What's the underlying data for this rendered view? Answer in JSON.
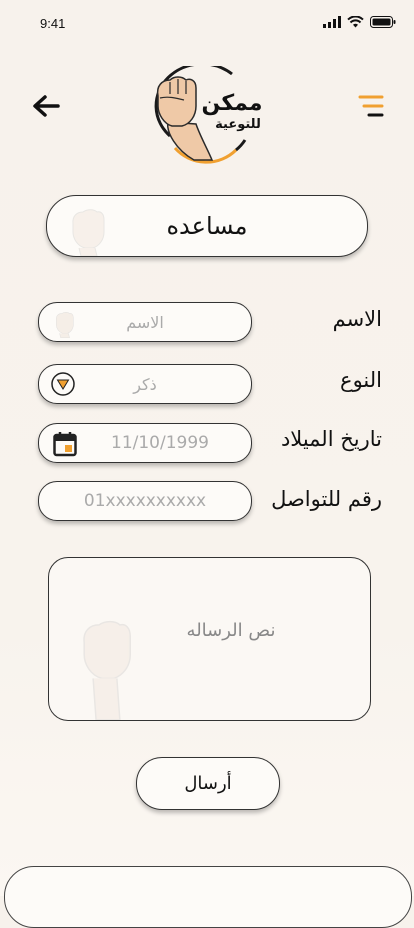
{
  "status_bar": {
    "time": "9:41"
  },
  "logo": {
    "text_top": "ممكن",
    "text_bottom": "للتوعية"
  },
  "header": {
    "title": "مساعده"
  },
  "form": {
    "name": {
      "label": "الاسم",
      "placeholder": "الاسم"
    },
    "gender": {
      "label": "النوع",
      "value": "ذكر"
    },
    "birthdate": {
      "label": "تاريخ الميلاد",
      "placeholder": "11/10/1999"
    },
    "phone": {
      "label": "رقم للتواصل",
      "placeholder": "01xxxxxxxxxx"
    },
    "message": {
      "placeholder": "نص الرساله"
    },
    "submit_label": "أرسال"
  },
  "colors": {
    "background": "#f7f2ec",
    "accent_orange": "#f0a030",
    "border": "#333333",
    "skin": "#efc9a7"
  },
  "icons": {
    "back": "arrow-left-icon",
    "menu": "menu-lines-icon",
    "gender_dropdown": "triangle-down-icon",
    "birthdate": "calendar-icon"
  }
}
